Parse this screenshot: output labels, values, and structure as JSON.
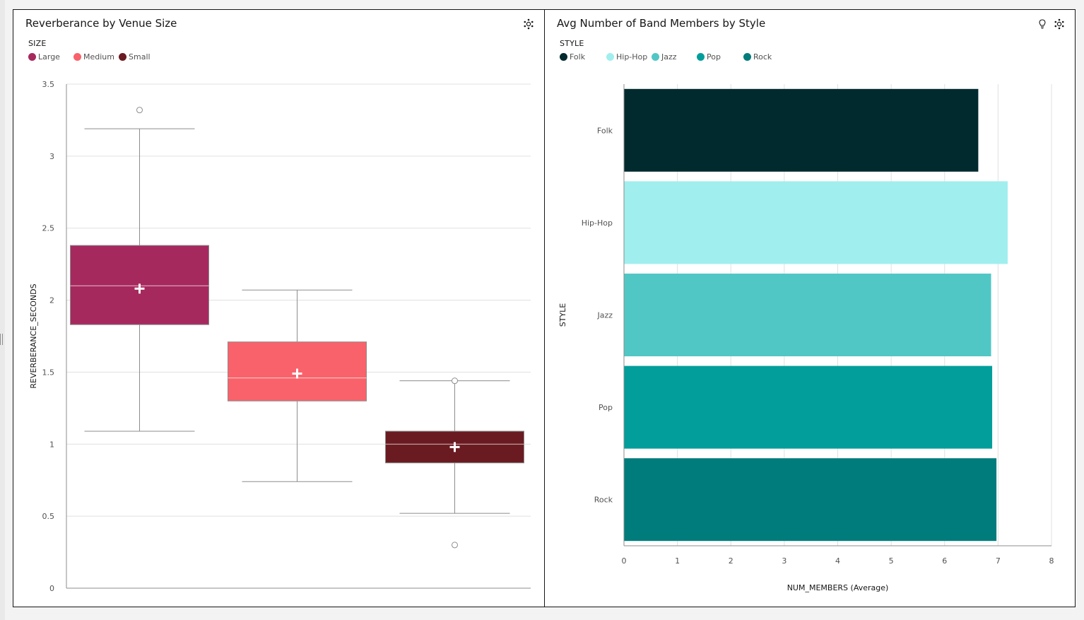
{
  "colors": {
    "grid": "#e0e0e0",
    "axis": "#8d8d8d",
    "tick_text": "#525252"
  },
  "left_panel": {
    "title": "Reverberance by Venue Size",
    "legend_title": "SIZE",
    "icons": [
      "settings-icon"
    ]
  },
  "right_panel": {
    "title": "Avg Number of Band Members by Style",
    "legend_title": "STYLE",
    "icons": [
      "lightbulb-icon",
      "settings-icon"
    ]
  },
  "chart_data": [
    {
      "type": "box",
      "title": "Reverberance by Venue Size",
      "ylabel": "REVERBERANCE_SECONDS",
      "xlabel": "",
      "legend_title": "SIZE",
      "legend_position": "top-left",
      "ylim": [
        0,
        3.5
      ],
      "y_ticks": [
        0,
        0.5,
        1,
        1.5,
        2,
        2.5,
        3,
        3.5
      ],
      "y_tick_labels": [
        "0",
        "0.5",
        "1",
        "1.5",
        "2",
        "2.5",
        "3",
        "3.5"
      ],
      "grid": true,
      "series": [
        {
          "name": "Large",
          "color": "#a6295e",
          "whisker_low": 1.09,
          "q1": 1.83,
          "median": 2.1,
          "q3": 2.38,
          "whisker_high": 3.19,
          "mean": 2.08,
          "outliers": [
            3.32
          ]
        },
        {
          "name": "Medium",
          "color": "#f9626a",
          "whisker_low": 0.74,
          "q1": 1.3,
          "median": 1.46,
          "q3": 1.71,
          "whisker_high": 2.07,
          "mean": 1.49,
          "outliers": []
        },
        {
          "name": "Small",
          "color": "#6a1b21",
          "whisker_low": 0.52,
          "q1": 0.87,
          "median": 1.0,
          "q3": 1.09,
          "whisker_high": 1.44,
          "mean": 0.98,
          "outliers": [
            0.3,
            1.44
          ]
        }
      ]
    },
    {
      "type": "bar",
      "orientation": "horizontal",
      "title": "Avg Number of Band Members by Style",
      "xlabel": "NUM_MEMBERS (Average)",
      "ylabel": "STYLE",
      "legend_title": "STYLE",
      "legend_position": "top-left",
      "xlim": [
        0,
        8
      ],
      "x_ticks": [
        0,
        1,
        2,
        3,
        4,
        5,
        6,
        7,
        8
      ],
      "x_tick_labels": [
        "0",
        "1",
        "2",
        "3",
        "4",
        "5",
        "6",
        "7",
        "8"
      ],
      "grid": true,
      "categories": [
        "Folk",
        "Hip-Hop",
        "Jazz",
        "Pop",
        "Rock"
      ],
      "values": [
        6.63,
        7.18,
        6.87,
        6.89,
        6.97
      ],
      "colors": [
        "#012a2f",
        "#a1eeef",
        "#51c7c5",
        "#019e9b",
        "#017c7c"
      ]
    }
  ]
}
